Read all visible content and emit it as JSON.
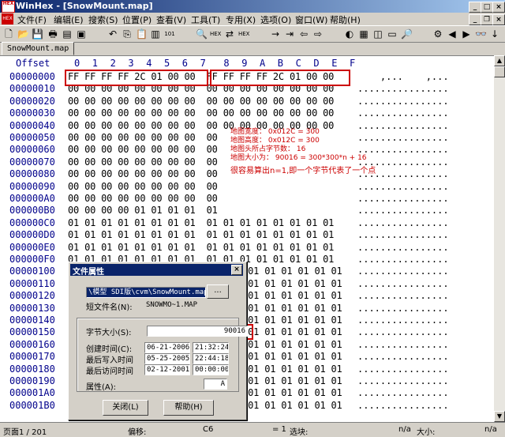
{
  "window": {
    "title": "WinHex - [SnowMount.map]",
    "logo": "HEX"
  },
  "menu": [
    "文件(F)",
    "编辑(E)",
    "搜索(S)",
    "位置(P)",
    "查看(V)",
    "工具(T)",
    "专用(X)",
    "选项(O)",
    "窗口(W)",
    "帮助(H)"
  ],
  "tab": {
    "label": "SnowMount.map"
  },
  "hex": {
    "offset_header": "Offset",
    "col_header": [
      "0",
      "1",
      "2",
      "3",
      "4",
      "5",
      "6",
      "7",
      "8",
      "9",
      "A",
      "B",
      "C",
      "D",
      "E",
      "F"
    ],
    "rows": [
      {
        "offset": "00000000",
        "bytes": "FF FF FF FF 2C 01 00 00  FF FF FF FF 2C 01 00 00",
        "ascii": "    ,...    ,..."
      },
      {
        "offset": "00000010",
        "bytes": "00 00 00 00 00 00 00 00  00 00 00 00 00 00 00 00",
        "ascii": "................"
      },
      {
        "offset": "00000020",
        "bytes": "00 00 00 00 00 00 00 00  00 00 00 00 00 00 00 00",
        "ascii": "................"
      },
      {
        "offset": "00000030",
        "bytes": "00 00 00 00 00 00 00 00  00 00 00 00 00 00 00 00",
        "ascii": "................"
      },
      {
        "offset": "00000040",
        "bytes": "00 00 00 00 00 00 00 00  00 00 00 00 00 00 00 00",
        "ascii": "................"
      },
      {
        "offset": "00000050",
        "bytes": "00 00 00 00 00 00 00 00  00",
        "ascii": "................"
      },
      {
        "offset": "00000060",
        "bytes": "00 00 00 00 00 00 00 00  00",
        "ascii": "................"
      },
      {
        "offset": "00000070",
        "bytes": "00 00 00 00 00 00 00 00  00",
        "ascii": "................"
      },
      {
        "offset": "00000080",
        "bytes": "00 00 00 00 00 00 00 00  00",
        "ascii": "................"
      },
      {
        "offset": "00000090",
        "bytes": "00 00 00 00 00 00 00 00  00",
        "ascii": "................"
      },
      {
        "offset": "000000A0",
        "bytes": "00 00 00 00 00 00 00 00  00",
        "ascii": "................"
      },
      {
        "offset": "000000B0",
        "bytes": "00 00 00 00 01 01 01 01  01",
        "ascii": "................"
      },
      {
        "offset": "000000C0",
        "bytes": "01 01 01 01 01 01 01 01  01 01 01 01 01 01 01 01",
        "ascii": "................"
      },
      {
        "offset": "000000D0",
        "bytes": "01 01 01 01 01 01 01 01  01 01 01 01 01 01 01 01",
        "ascii": "................"
      },
      {
        "offset": "000000E0",
        "bytes": "01 01 01 01 01 01 01 01  01 01 01 01 01 01 01 01",
        "ascii": "................"
      },
      {
        "offset": "000000F0",
        "bytes": "01 01 01 01 01 01 01 01  01 01 01 01 01 01 01 01",
        "ascii": "................"
      },
      {
        "offset": "00000100",
        "bytes": "",
        "ascii": "................"
      },
      {
        "offset": "00000110",
        "bytes": "",
        "ascii": "................"
      },
      {
        "offset": "00000120",
        "bytes": "",
        "ascii": "................"
      },
      {
        "offset": "00000130",
        "bytes": "",
        "ascii": "................"
      },
      {
        "offset": "00000140",
        "bytes": "",
        "ascii": "................"
      },
      {
        "offset": "00000150",
        "bytes": "",
        "ascii": "................"
      },
      {
        "offset": "00000160",
        "bytes": "",
        "ascii": "................"
      },
      {
        "offset": "00000170",
        "bytes": "",
        "ascii": "................"
      },
      {
        "offset": "00000180",
        "bytes": "",
        "ascii": "................"
      },
      {
        "offset": "00000190",
        "bytes": "",
        "ascii": "................"
      },
      {
        "offset": "000001A0",
        "bytes": "",
        "ascii": "................"
      },
      {
        "offset": "000001B0",
        "bytes": "",
        "ascii": "................"
      }
    ],
    "right_bytes": "01 01 01 01 01 01 01 01"
  },
  "annotation": {
    "lines": [
      "地图宽度： 0x012C  =  300",
      "地图高度： 0x012C  =  300",
      "地图头所占字节数： 16",
      "地图大小为：  90016 = 300*300*n + 16",
      "",
      "很容易算出n=1,即一个字节代表了一个点"
    ]
  },
  "dialog": {
    "title": "文件属性",
    "path": "\\模型 SDI版\\cvm\\SnowMount.map",
    "browse": "...",
    "short_name_label": "短文件名(N):",
    "short_name": "SNOWMO~1.MAP",
    "size_label": "字节大小(S):",
    "size": "90016",
    "created_label": "创建时间(C):",
    "created_date": "06-21-2006",
    "created_time": "21:32:24",
    "written_label": "最后写入时间",
    "written_date": "05-25-2005",
    "written_time": "22:44:18",
    "accessed_label": "最后访问时间",
    "accessed_date": "02-12-2001",
    "accessed_time": "00:00:00",
    "attr_label": "属性(A):",
    "attr": "A",
    "close": "关闭(L)",
    "help": "帮助(H)"
  },
  "status": {
    "page": "页面1 / 201",
    "offset_label": "偏移:",
    "offset": "C6",
    "eq": "= 1",
    "select_label": "选块:",
    "na1": "n/a",
    "size_label": "大小:",
    "na2": "n/a"
  }
}
